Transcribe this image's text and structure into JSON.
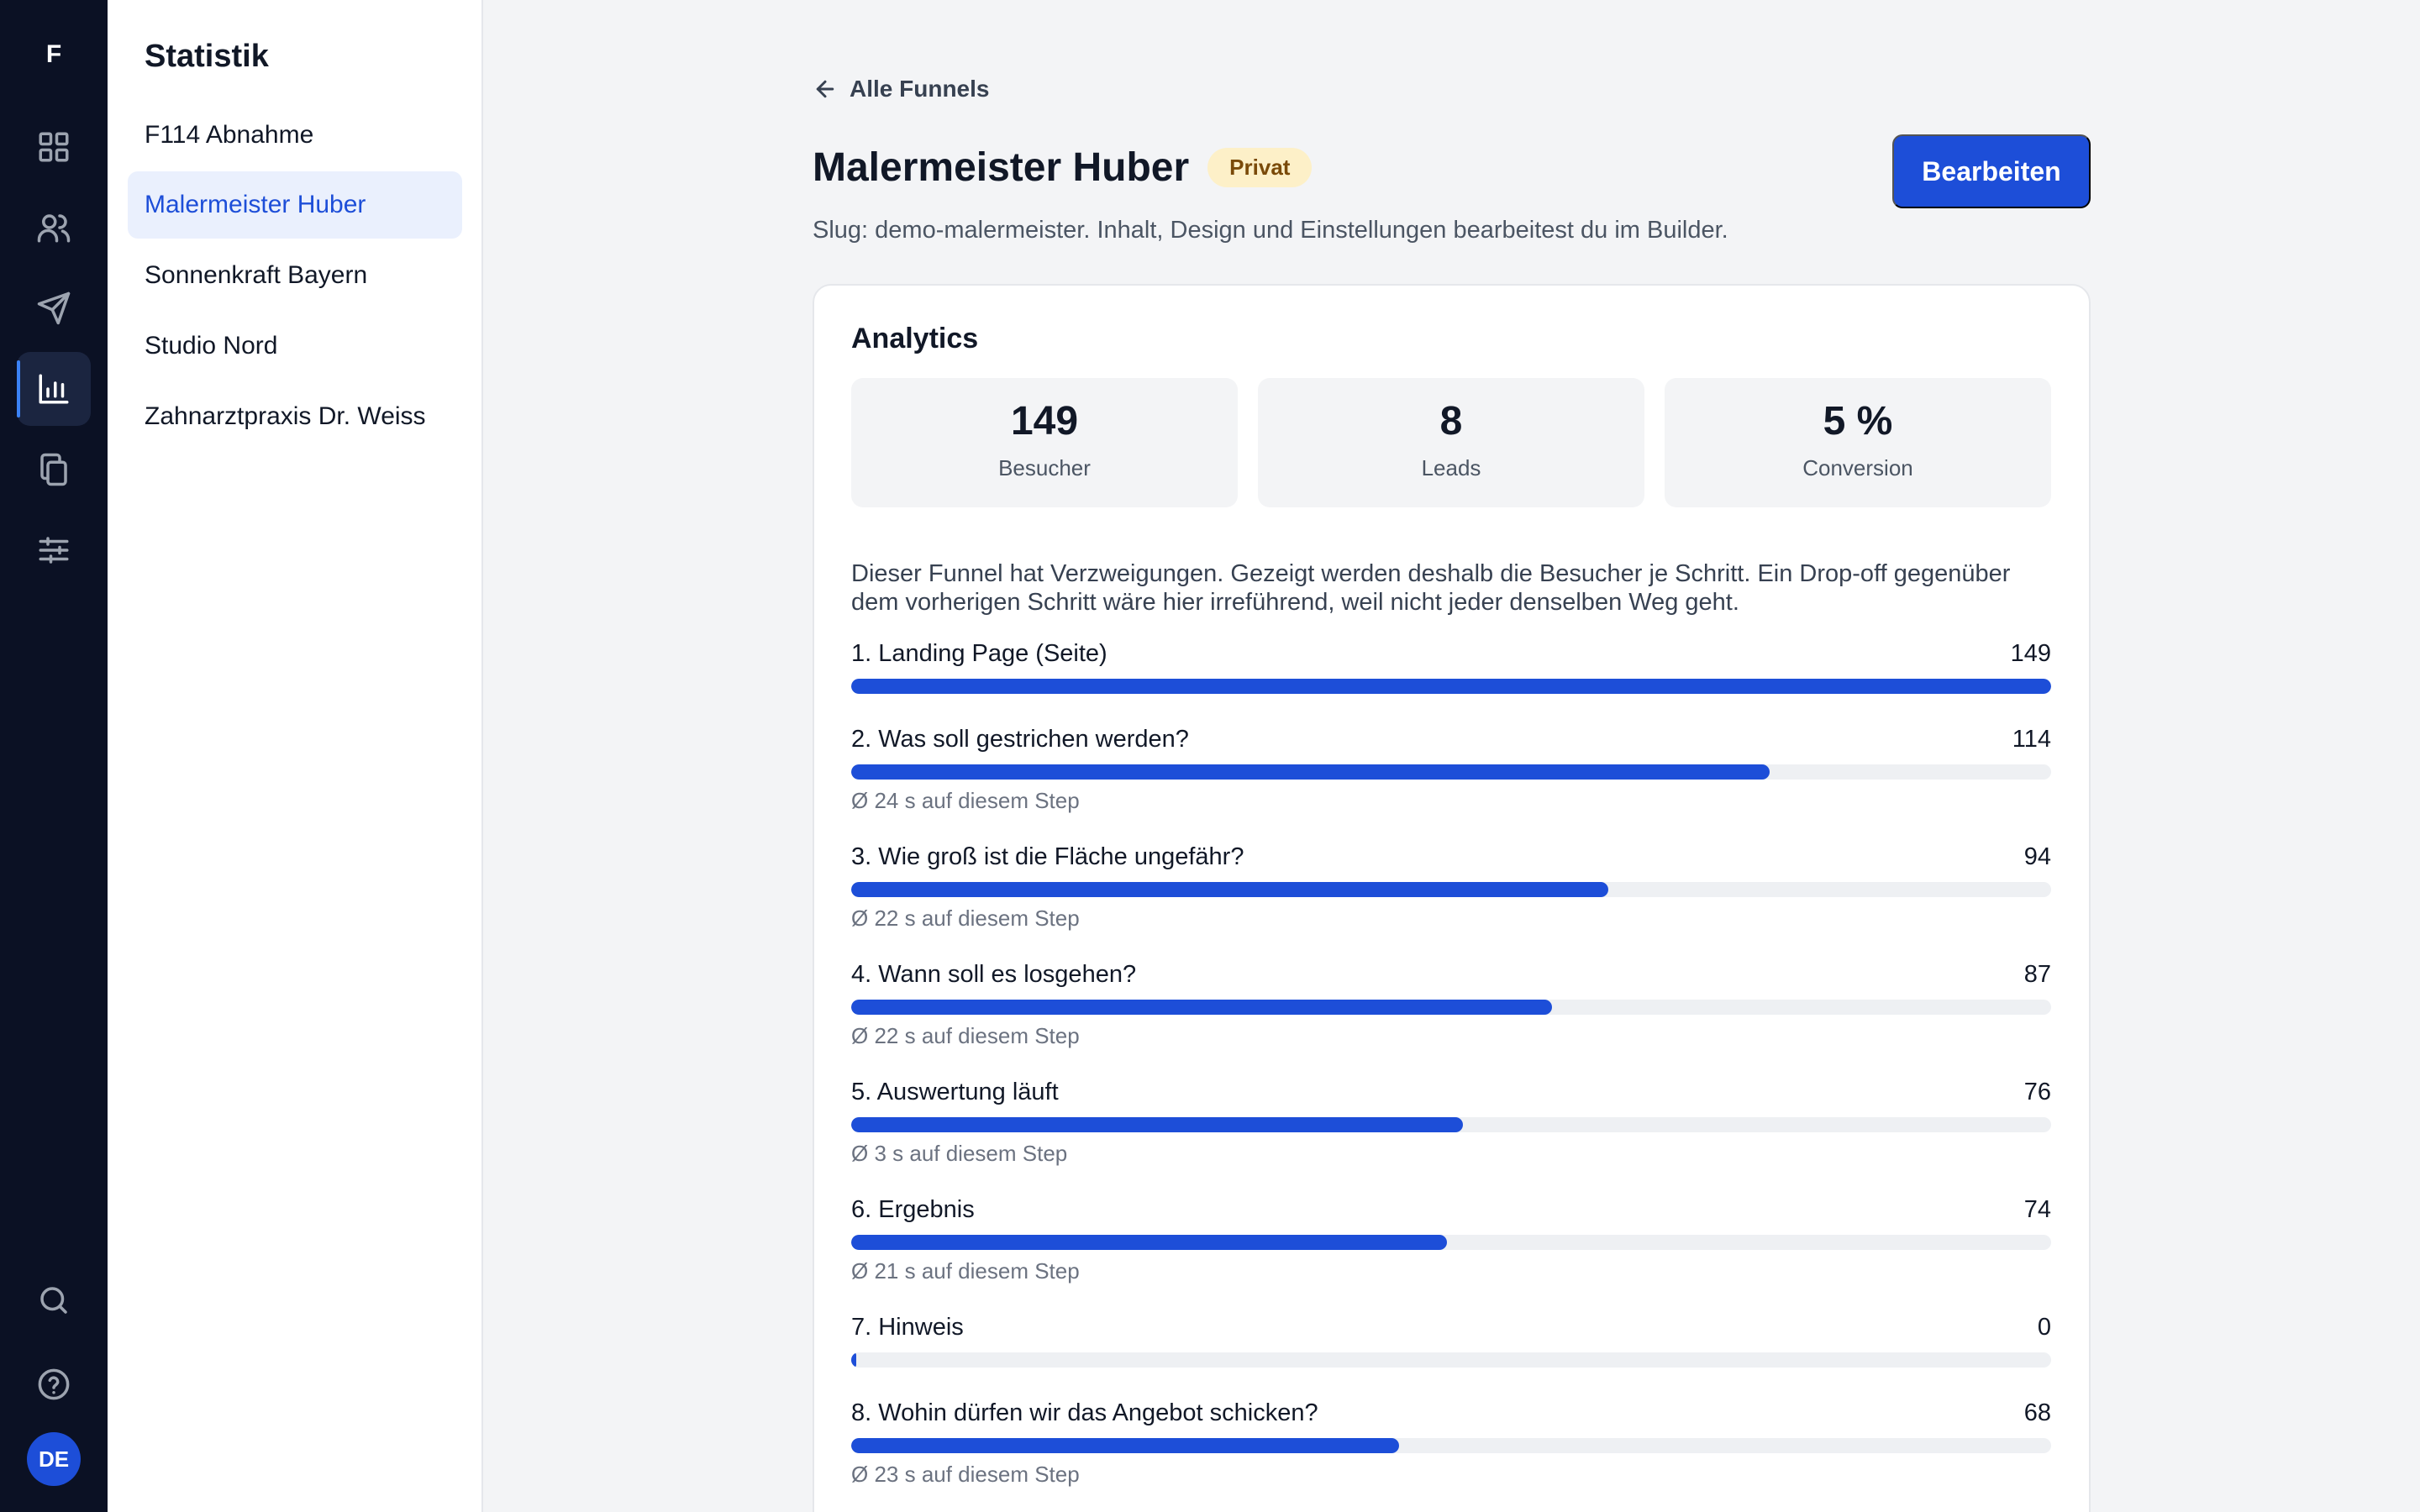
{
  "rail": {
    "logo": "F",
    "avatar": "DE"
  },
  "sidebar": {
    "title": "Statistik",
    "items": [
      {
        "label": "F114 Abnahme"
      },
      {
        "label": "Malermeister Huber"
      },
      {
        "label": "Sonnenkraft Bayern"
      },
      {
        "label": "Studio Nord"
      },
      {
        "label": "Zahnarztpraxis Dr. Weiss"
      }
    ]
  },
  "header": {
    "back_label": "Alle Funnels",
    "title": "Malermeister Huber",
    "badge": "Privat",
    "edit_label": "Bearbeiten",
    "slug_text": "Slug: demo-malermeister. Inhalt, Design und Einstellungen bearbeitest du im Builder."
  },
  "analytics": {
    "title": "Analytics",
    "stats": [
      {
        "value": "149",
        "label": "Besucher"
      },
      {
        "value": "8",
        "label": "Leads"
      },
      {
        "value": "5 %",
        "label": "Conversion"
      }
    ],
    "note": "Dieser Funnel hat Verzweigungen. Gezeigt werden deshalb die Besucher je Schritt. Ein Drop-off gegenüber dem vorherigen Schritt wäre hier irreführend, weil nicht jeder denselben Weg geht.",
    "max_visitors": 149,
    "steps": [
      {
        "label": "1. Landing Page (Seite)",
        "count": "149",
        "value": 149,
        "avg": ""
      },
      {
        "label": "2. Was soll gestrichen werden?",
        "count": "114",
        "value": 114,
        "avg": "Ø 24 s auf diesem Step"
      },
      {
        "label": "3. Wie groß ist die Fläche ungefähr?",
        "count": "94",
        "value": 94,
        "avg": "Ø 22 s auf diesem Step"
      },
      {
        "label": "4. Wann soll es losgehen?",
        "count": "87",
        "value": 87,
        "avg": "Ø 22 s auf diesem Step"
      },
      {
        "label": "5. Auswertung läuft",
        "count": "76",
        "value": 76,
        "avg": "Ø 3 s auf diesem Step"
      },
      {
        "label": "6. Ergebnis",
        "count": "74",
        "value": 74,
        "avg": "Ø 21 s auf diesem Step"
      },
      {
        "label": "7. Hinweis",
        "count": "0",
        "value": 0,
        "avg": ""
      },
      {
        "label": "8. Wohin dürfen wir das Angebot schicken?",
        "count": "68",
        "value": 68,
        "avg": "Ø 23 s auf diesem Step"
      }
    ]
  },
  "colors": {
    "accent": "#1d4ed8",
    "rail_bg": "#0b1124",
    "badge_bg": "#fdf0c8"
  }
}
